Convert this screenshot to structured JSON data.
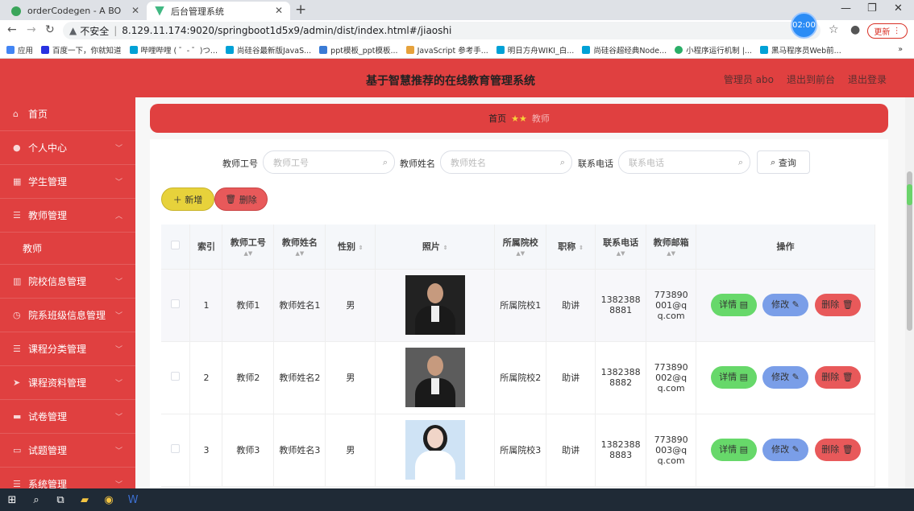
{
  "browser": {
    "tabs": [
      {
        "title": "orderCodegen - A BO",
        "active": false
      },
      {
        "title": "后台管理系统",
        "active": true
      }
    ],
    "url_warning": "不安全",
    "url": "8.129.11.174:9020/springboot1d5x9/admin/dist/index.html#/jiaoshi",
    "clock": "02:00",
    "update_label": "更新",
    "bookmarks": [
      "应用",
      "百度一下，你就知道",
      "哔哩哔哩 ( ゜- ゜)つ...",
      "尚硅谷最新版JavaS...",
      "ppt模板_ppt模板...",
      "JavaScript 参考手...",
      "明日方舟WIKI_白...",
      "尚硅谷超经典Node...",
      "小程序运行机制 |...",
      "黑马程序员Web前..."
    ],
    "more": "»"
  },
  "header": {
    "title": "基于智慧推荐的在线教育管理系统",
    "links": [
      "管理员 abo",
      "退出到前台",
      "退出登录"
    ]
  },
  "sidebar": {
    "items": [
      {
        "label": "首页",
        "icon": "home-icon",
        "expandable": false
      },
      {
        "label": "个人中心",
        "icon": "user-icon",
        "expandable": true
      },
      {
        "label": "学生管理",
        "icon": "grid-icon",
        "expandable": true
      },
      {
        "label": "教师管理",
        "icon": "list-icon",
        "expandable": true,
        "expanded": true
      },
      {
        "label": "教师",
        "icon": "",
        "expandable": false,
        "sub": true
      },
      {
        "label": "院校信息管理",
        "icon": "chart-icon",
        "expandable": true
      },
      {
        "label": "院系班级信息管理",
        "icon": "clock-icon",
        "expandable": true
      },
      {
        "label": "课程分类管理",
        "icon": "list-icon",
        "expandable": true
      },
      {
        "label": "课程资料管理",
        "icon": "send-icon",
        "expandable": true
      },
      {
        "label": "试卷管理",
        "icon": "chat-icon",
        "expandable": true
      },
      {
        "label": "试题管理",
        "icon": "monitor-icon",
        "expandable": true
      },
      {
        "label": "系统管理",
        "icon": "list-icon",
        "expandable": true
      }
    ]
  },
  "breadcrumb": {
    "home": "首页",
    "current": "教师"
  },
  "search": {
    "fields": [
      {
        "label": "教师工号",
        "placeholder": "教师工号"
      },
      {
        "label": "教师姓名",
        "placeholder": "教师姓名"
      },
      {
        "label": "联系电话",
        "placeholder": "联系电话"
      }
    ],
    "query_label": "查询"
  },
  "actions": {
    "add_label": "新增",
    "delete_label": "删除"
  },
  "table": {
    "headers": [
      "索引",
      "教师工号",
      "教师姓名",
      "性别",
      "照片",
      "所属院校",
      "职称",
      "联系电话",
      "教师邮箱",
      "操作"
    ],
    "rows": [
      {
        "index": "1",
        "gonghao": "教师1",
        "name": "教师姓名1",
        "gender": "男",
        "school": "所属院校1",
        "title": "助讲",
        "phone": "13823888881",
        "email": "773890001@qq.com"
      },
      {
        "index": "2",
        "gonghao": "教师2",
        "name": "教师姓名2",
        "gender": "男",
        "school": "所属院校2",
        "title": "助讲",
        "phone": "13823888882",
        "email": "773890002@qq.com"
      },
      {
        "index": "3",
        "gonghao": "教师3",
        "name": "教师姓名3",
        "gender": "男",
        "school": "所属院校3",
        "title": "助讲",
        "phone": "13823888883",
        "email": "773890003@qq.com"
      }
    ],
    "op_labels": {
      "detail": "详情",
      "edit": "修改",
      "delete": "删除"
    }
  }
}
